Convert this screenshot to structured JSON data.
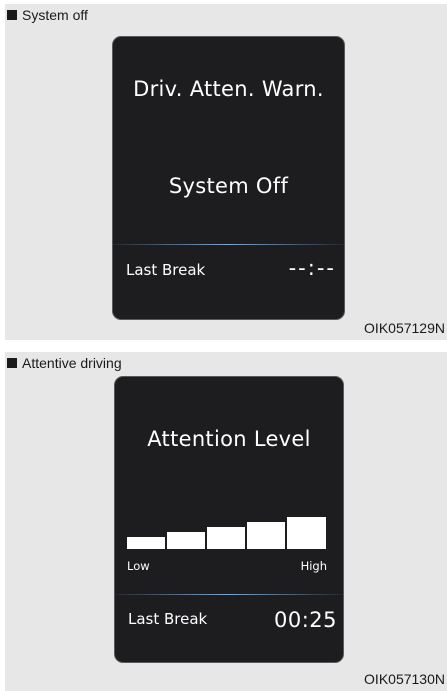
{
  "panels": [
    {
      "caption": "System off",
      "figure_code": "OIK057129N",
      "screen": {
        "title": "Driv. Atten. Warn.",
        "status": "System Off",
        "last_break_label": "Last Break",
        "last_break_value": "--:--"
      }
    },
    {
      "caption": "Attentive driving",
      "figure_code": "OIK057130N",
      "screen": {
        "title": "Attention Level",
        "gauge": {
          "low_label": "Low",
          "high_label": "High",
          "segments_total": 5,
          "segments_filled": 5
        },
        "last_break_label": "Last Break",
        "last_break_value": "00:25"
      }
    }
  ]
}
